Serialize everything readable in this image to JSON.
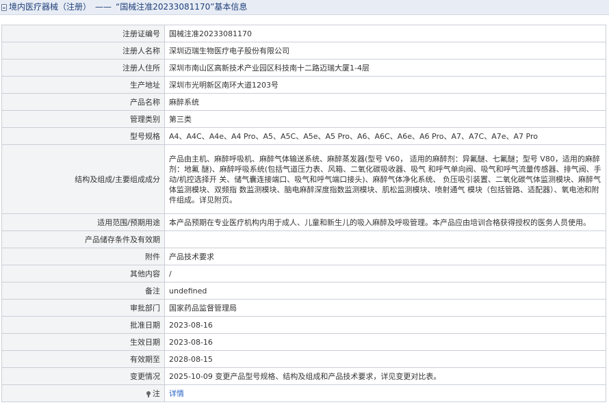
{
  "header": {
    "breadcrumb_section": "境内医疗器械（注册）",
    "separator": "——",
    "title": "“国械注准20233081170”基本信息"
  },
  "rows": [
    {
      "label": "注册证编号",
      "value": "国械注准20233081170"
    },
    {
      "label": "注册人名称",
      "value": "深圳迈瑞生物医疗电子股份有限公司"
    },
    {
      "label": "注册人住所",
      "value": "深圳市南山区高新技术产业园区科技南十二路迈瑞大厦1-4层"
    },
    {
      "label": "生产地址",
      "value": "深圳市光明新区南环大道1203号"
    },
    {
      "label": "产品名称",
      "value": "麻醉系统"
    },
    {
      "label": "管理类别",
      "value": "第三类"
    },
    {
      "label": "型号规格",
      "value": "A4、A4C、A4e、A4 Pro、A5、A5C、A5e、A5 Pro、A6、A6C、A6e、A6 Pro、A7、A7C、A7e、A7 Pro"
    },
    {
      "label": "结构及组成/主要组成成分",
      "value": "产品由主机、麻醉呼吸机、麻醉气体输送系统、麻醉蒸发器(型号 V60， 适用的麻醉剂：异氟醚、七氟醚；型号 V80，适用的麻醉剂：地氟 醚)、麻醉呼吸系统(包括气道压力表、风箱、二氧化碳吸收器、吸气 和呼气单向阀、吸气和呼气流量传感器、排气阀、手动/机控选择开 关、储气囊连接端口、吸气和呼气端口接头)、麻醉气体净化系统、 负压吸引装置、二氧化碳气体监测模块、麻醉气体监测模块、双频指 数监测模块、脑电麻醉深度指数监测模块、肌松监测模块、喷射通气 模块（包括管路、适配器）、氧电池和附件组成。详见附页。"
    },
    {
      "label": "适用范围/预期用途",
      "value": "本产品预期在专业医疗机构内用于成人、儿童和新生儿的吸入麻醉及呼吸管理。本产品应由培训合格获得授权的医务人员使用。"
    },
    {
      "label": "产品储存条件及有效期",
      "value": ""
    },
    {
      "label": "附件",
      "value": "产品技术要求"
    },
    {
      "label": "其他内容",
      "value": "/"
    },
    {
      "label": "备注",
      "value": "undefined"
    },
    {
      "label": "审批部门",
      "value": "国家药品监督管理局"
    },
    {
      "label": "批准日期",
      "value": "2023-08-16"
    },
    {
      "label": "生效日期",
      "value": "2023-08-16"
    },
    {
      "label": "有效期至",
      "value": "2028-08-15"
    },
    {
      "label": "变更情况",
      "value": "2025-10-09 变更产品型号规格、结构及组成和产品技术要求，详见变更对比表。"
    }
  ],
  "note_row": {
    "label": "注",
    "link_text": "详情",
    "icon": "pin-icon"
  },
  "colors": {
    "header_bg": "#e8edf5",
    "header_text": "#1f3f7a",
    "label_bg": "#f3f4f6",
    "border": "#c9ced6",
    "link": "#2a64c5"
  }
}
